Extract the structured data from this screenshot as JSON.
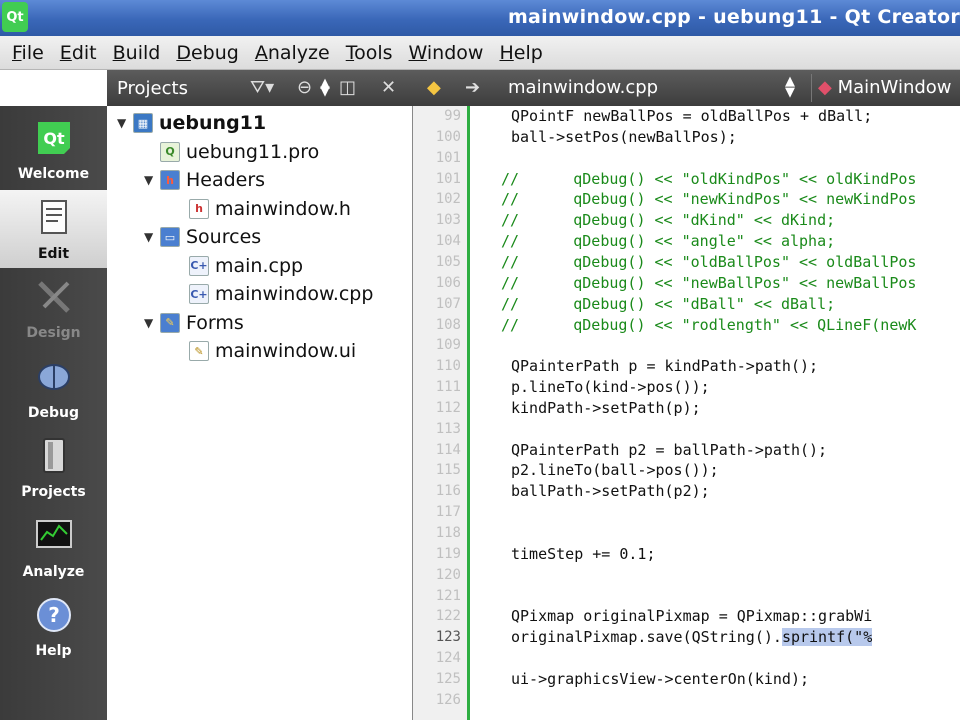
{
  "window": {
    "title": "mainwindow.cpp - uebung11 - Qt Creator"
  },
  "menubar": {
    "items": [
      "File",
      "Edit",
      "Build",
      "Debug",
      "Analyze",
      "Tools",
      "Window",
      "Help"
    ]
  },
  "modes": [
    {
      "label": "Welcome",
      "icon": "qt-logo-icon",
      "state": "normal"
    },
    {
      "label": "Edit",
      "icon": "document-icon",
      "state": "active"
    },
    {
      "label": "Design",
      "icon": "design-tools-icon",
      "state": "disabled"
    },
    {
      "label": "Debug",
      "icon": "bug-icon",
      "state": "normal"
    },
    {
      "label": "Projects",
      "icon": "projects-book-icon",
      "state": "normal"
    },
    {
      "label": "Analyze",
      "icon": "analyze-monitor-icon",
      "state": "normal"
    },
    {
      "label": "Help",
      "icon": "help-icon",
      "state": "normal"
    }
  ],
  "projects_pane": {
    "selector": "Projects",
    "tree": [
      {
        "label": "uebung11",
        "icon": "project-icon",
        "expanded": true,
        "bold": true,
        "depth": 0
      },
      {
        "label": "uebung11.pro",
        "icon": "pro-file-icon",
        "depth": 1
      },
      {
        "label": "Headers",
        "icon": "headers-folder-icon",
        "expanded": true,
        "depth": 1
      },
      {
        "label": "mainwindow.h",
        "icon": "header-file-icon",
        "depth": 2
      },
      {
        "label": "Sources",
        "icon": "sources-folder-icon",
        "expanded": true,
        "depth": 1
      },
      {
        "label": "main.cpp",
        "icon": "cpp-file-icon",
        "depth": 2
      },
      {
        "label": "mainwindow.cpp",
        "icon": "cpp-file-icon",
        "depth": 2
      },
      {
        "label": "Forms",
        "icon": "forms-folder-icon",
        "expanded": true,
        "depth": 1
      },
      {
        "label": "mainwindow.ui",
        "icon": "ui-file-icon",
        "depth": 2
      }
    ]
  },
  "editor": {
    "file": "mainwindow.cpp",
    "symbol": "MainWindow",
    "current_line": "123",
    "lines": [
      {
        "num": "99",
        "text": "    QPointF newBallPos = oldBallPos + dBall;",
        "type": "code"
      },
      {
        "num": "100",
        "text": "    ball->setPos(newBallPos);",
        "type": "code"
      },
      {
        "num": "101",
        "text": "",
        "type": "code"
      },
      {
        "num": "101",
        "text": "//      qDebug() << \"oldKindPos\" << oldKindPos",
        "type": "comment"
      },
      {
        "num": "102",
        "text": "//      qDebug() << \"newKindPos\" << newKindPos",
        "type": "comment"
      },
      {
        "num": "103",
        "text": "//      qDebug() << \"dKind\" << dKind;",
        "type": "comment"
      },
      {
        "num": "104",
        "text": "//      qDebug() << \"angle\" << alpha;",
        "type": "comment"
      },
      {
        "num": "105",
        "text": "//      qDebug() << \"oldBallPos\" << oldBallPos",
        "type": "comment"
      },
      {
        "num": "106",
        "text": "//      qDebug() << \"newBallPos\" << newBallPos",
        "type": "comment"
      },
      {
        "num": "107",
        "text": "//      qDebug() << \"dBall\" << dBall;",
        "type": "comment"
      },
      {
        "num": "108",
        "text": "//      qDebug() << \"rodlength\" << QLineF(newK",
        "type": "comment"
      },
      {
        "num": "109",
        "text": "",
        "type": "code"
      },
      {
        "num": "110",
        "text": "    QPainterPath p = kindPath->path();",
        "type": "code"
      },
      {
        "num": "111",
        "text": "    p.lineTo(kind->pos());",
        "type": "code"
      },
      {
        "num": "112",
        "text": "    kindPath->setPath(p);",
        "type": "code"
      },
      {
        "num": "113",
        "text": "",
        "type": "code"
      },
      {
        "num": "114",
        "text": "    QPainterPath p2 = ballPath->path();",
        "type": "code"
      },
      {
        "num": "115",
        "text": "    p2.lineTo(ball->pos());",
        "type": "code"
      },
      {
        "num": "116",
        "text": "    ballPath->setPath(p2);",
        "type": "code"
      },
      {
        "num": "117",
        "text": "",
        "type": "code"
      },
      {
        "num": "118",
        "text": "",
        "type": "code"
      },
      {
        "num": "119",
        "text": "    timeStep += 0.1;",
        "type": "code"
      },
      {
        "num": "120",
        "text": "",
        "type": "code"
      },
      {
        "num": "121",
        "text": "",
        "type": "code"
      },
      {
        "num": "122",
        "text": "    QPixmap originalPixmap = QPixmap::grabWi",
        "type": "code"
      },
      {
        "num": "123",
        "text": "    originalPixmap.save(QString().",
        "type": "code",
        "selected": "sprintf(\"%"
      },
      {
        "num": "124",
        "text": "",
        "type": "code"
      },
      {
        "num": "125",
        "text": "    ui->graphicsView->centerOn(kind);",
        "type": "code"
      },
      {
        "num": "126",
        "text": "",
        "type": "code"
      }
    ]
  },
  "colors": {
    "titlebar": "#3a67b8",
    "modebar": "#404040",
    "comment": "#1a8a1a",
    "change_marker": "#2eae42",
    "selection": "#b8c9ec"
  }
}
